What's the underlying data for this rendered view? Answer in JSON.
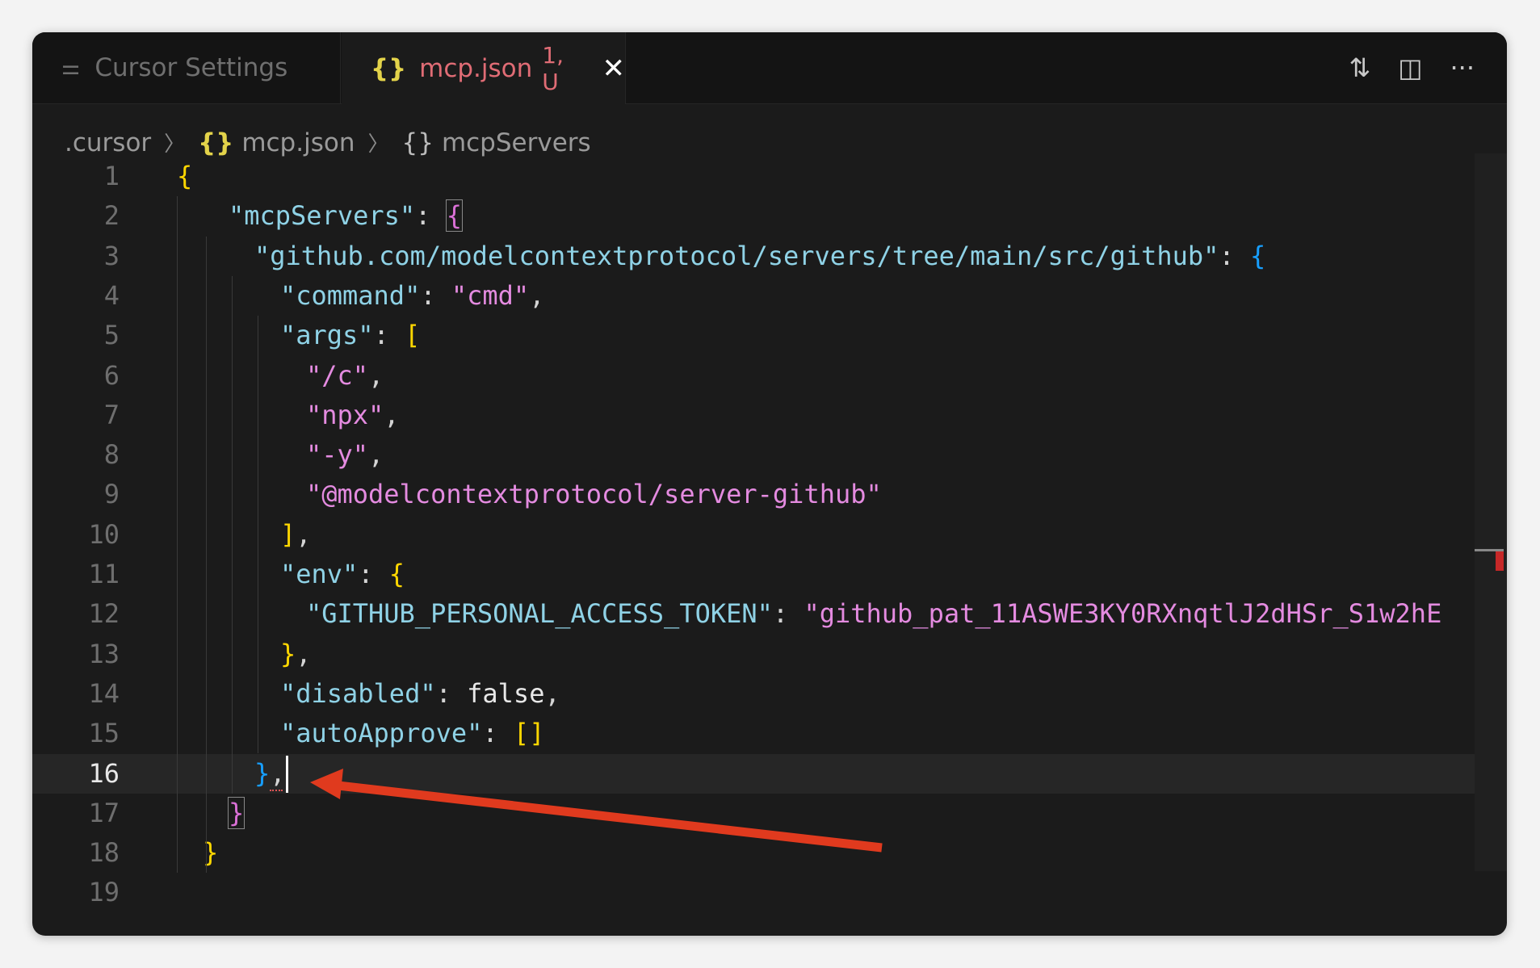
{
  "tabs": [
    {
      "label": "Cursor Settings",
      "icon": "settings-sliders-icon",
      "active": false
    },
    {
      "label": "mcp.json",
      "icon": "json-braces-icon",
      "status": "1, U",
      "active": true,
      "close_icon": "close-icon"
    }
  ],
  "actions": [
    {
      "name": "compare-changes-icon",
      "glyph": "⇅"
    },
    {
      "name": "split-editor-icon",
      "glyph": "◫"
    },
    {
      "name": "more-actions-icon",
      "glyph": "···"
    }
  ],
  "breadcrumb": {
    "folder": ".cursor",
    "file_icon": "{}",
    "file": "mcp.json",
    "symbol_icon": "{}",
    "symbol": "mcpServers"
  },
  "editor": {
    "current_line": 16,
    "lines": [
      {
        "n": "1",
        "indent": 0,
        "tokens": [
          [
            "{",
            "b1"
          ]
        ]
      },
      {
        "n": "2",
        "indent": 4,
        "tokens": [
          [
            "\"mcpServers\"",
            "k"
          ],
          [
            ": ",
            "p"
          ],
          [
            "{",
            "b2 boxed"
          ]
        ]
      },
      {
        "n": "3",
        "indent": 6,
        "tokens": [
          [
            "\"github.com/modelcontextprotocol/servers/tree/main/src/github\"",
            "k"
          ],
          [
            ": ",
            "p"
          ],
          [
            "{",
            "b3"
          ]
        ]
      },
      {
        "n": "4",
        "indent": 8,
        "tokens": [
          [
            "\"command\"",
            "k"
          ],
          [
            ": ",
            "p"
          ],
          [
            "\"cmd\"",
            "s"
          ],
          [
            ",",
            "p"
          ]
        ]
      },
      {
        "n": "5",
        "indent": 8,
        "tokens": [
          [
            "\"args\"",
            "k"
          ],
          [
            ": ",
            "p"
          ],
          [
            "[",
            "b1"
          ]
        ]
      },
      {
        "n": "6",
        "indent": 10,
        "tokens": [
          [
            "\"/c\"",
            "s"
          ],
          [
            ",",
            "p"
          ]
        ]
      },
      {
        "n": "7",
        "indent": 10,
        "tokens": [
          [
            "\"npx\"",
            "s"
          ],
          [
            ",",
            "p"
          ]
        ]
      },
      {
        "n": "8",
        "indent": 10,
        "tokens": [
          [
            "\"-y\"",
            "s"
          ],
          [
            ",",
            "p"
          ]
        ]
      },
      {
        "n": "9",
        "indent": 10,
        "tokens": [
          [
            "\"@modelcontextprotocol/server-github\"",
            "s"
          ]
        ]
      },
      {
        "n": "10",
        "indent": 8,
        "tokens": [
          [
            "]",
            "b1"
          ],
          [
            ",",
            "p"
          ]
        ]
      },
      {
        "n": "11",
        "indent": 8,
        "tokens": [
          [
            "\"env\"",
            "k"
          ],
          [
            ": ",
            "p"
          ],
          [
            "{",
            "b1"
          ]
        ]
      },
      {
        "n": "12",
        "indent": 10,
        "tokens": [
          [
            "\"GITHUB_PERSONAL_ACCESS_TOKEN\"",
            "k"
          ],
          [
            ": ",
            "p"
          ],
          [
            "\"github_pat_11ASWE3KY0RXnqtlJ2dHSr_S1w2hE",
            "s"
          ]
        ]
      },
      {
        "n": "13",
        "indent": 8,
        "tokens": [
          [
            "}",
            "b1"
          ],
          [
            ",",
            "p"
          ]
        ]
      },
      {
        "n": "14",
        "indent": 8,
        "tokens": [
          [
            "\"disabled\"",
            "k"
          ],
          [
            ": ",
            "p"
          ],
          [
            "false",
            "w"
          ],
          [
            ",",
            "p"
          ]
        ]
      },
      {
        "n": "15",
        "indent": 8,
        "tokens": [
          [
            "\"autoApprove\"",
            "k"
          ],
          [
            ": ",
            "p"
          ],
          [
            "[]",
            "b1"
          ]
        ]
      },
      {
        "n": "16",
        "indent": 6,
        "tokens": [
          [
            "}",
            "b3"
          ],
          [
            ",",
            "p"
          ]
        ]
      },
      {
        "n": "17",
        "indent": 4,
        "tokens": [
          [
            "}",
            "b2 boxed"
          ]
        ]
      },
      {
        "n": "18",
        "indent": 2,
        "tokens": [
          [
            "}",
            "b1"
          ]
        ]
      },
      {
        "n": "19",
        "indent": 0,
        "tokens": []
      }
    ]
  },
  "colors": {
    "annotation_arrow": "#e03a1e",
    "error_marker": "#c62828"
  }
}
